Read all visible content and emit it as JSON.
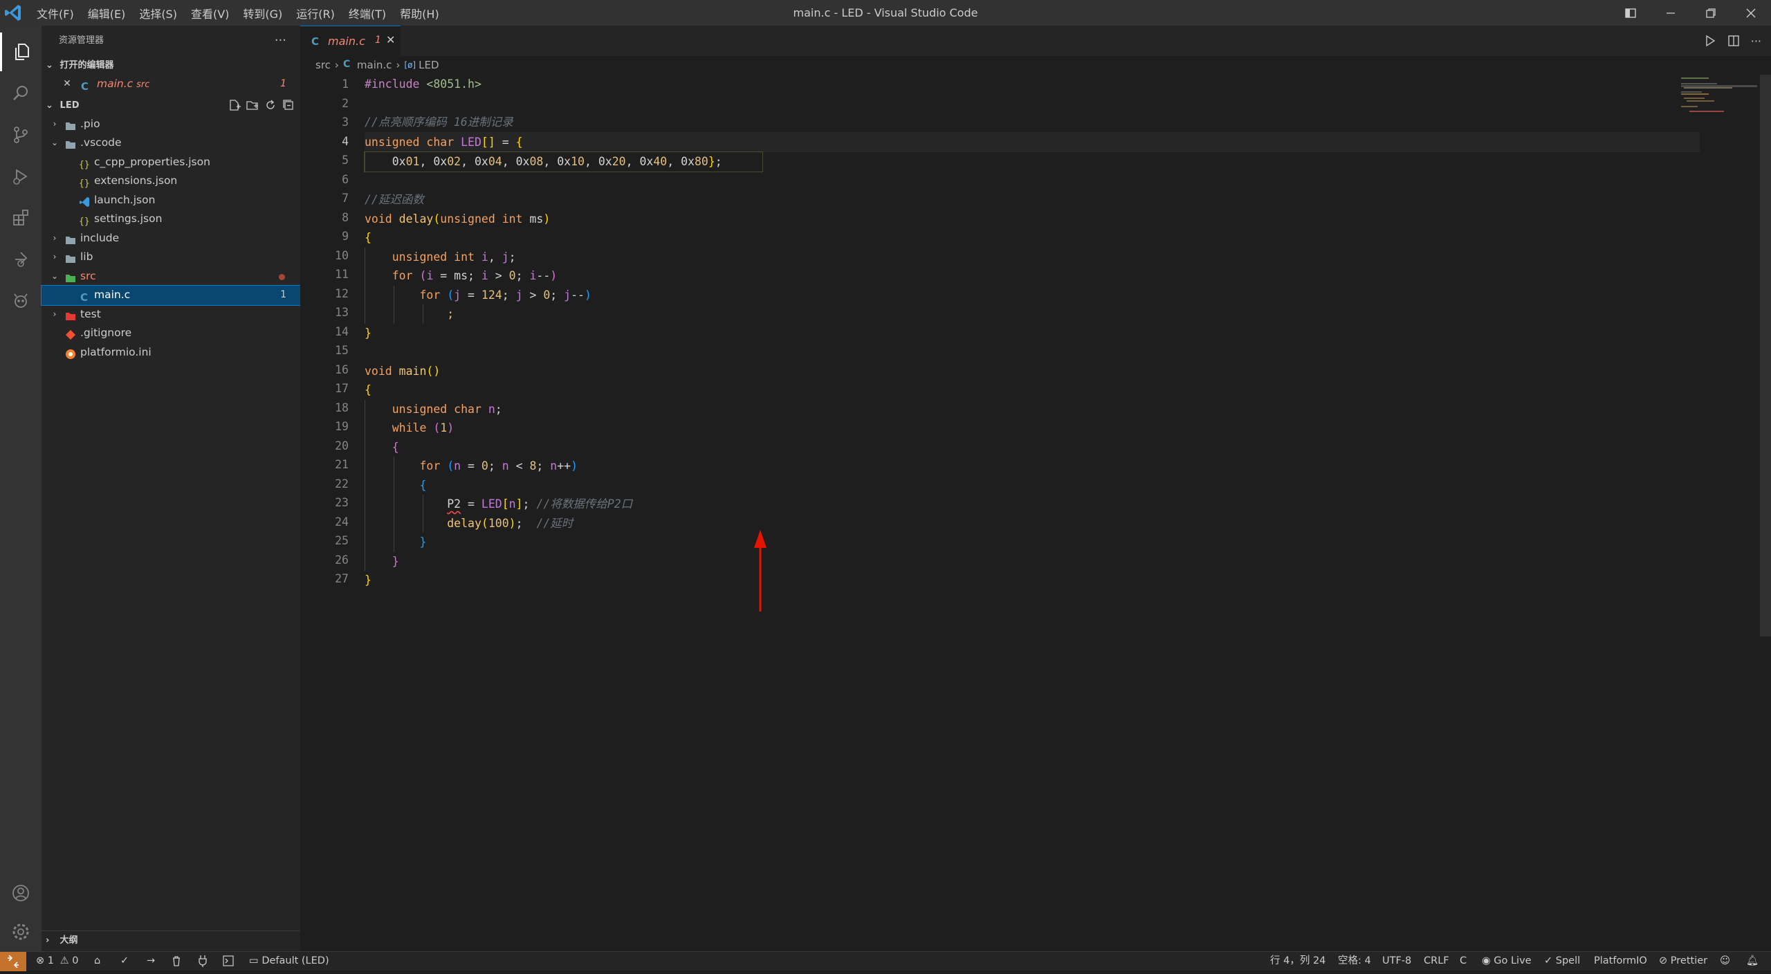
{
  "window": {
    "title": "main.c - LED - Visual Studio Code",
    "menu": [
      "文件(F)",
      "编辑(E)",
      "选择(S)",
      "查看(V)",
      "转到(G)",
      "运行(R)",
      "终端(T)",
      "帮助(H)"
    ]
  },
  "colors": {
    "accent": "#007acc",
    "selected_row": "#094771",
    "remote": "#c5722d",
    "error": "#f14c4c",
    "annotation_arrow": "#e51400"
  },
  "activity_bar": {
    "items": [
      "explorer-icon",
      "search-icon",
      "source-control-icon",
      "run-debug-icon",
      "extensions-icon",
      "remote-icon",
      "platformio-icon"
    ],
    "bottom": [
      "account-icon",
      "settings-gear-icon"
    ]
  },
  "sidebar": {
    "title": "资源管理器",
    "open_editors": {
      "title": "打开的编辑器",
      "items": [
        {
          "name": "main.c",
          "path": "src",
          "badge": "1"
        }
      ]
    },
    "project": {
      "title": "LED",
      "tree": [
        {
          "name": ".pio",
          "type": "folder",
          "depth": 0,
          "expanded": false,
          "badge": ""
        },
        {
          "name": ".vscode",
          "type": "folder",
          "depth": 0,
          "expanded": true,
          "badge": ""
        },
        {
          "name": "c_cpp_properties.json",
          "type": "json",
          "depth": 1,
          "badge": ""
        },
        {
          "name": "extensions.json",
          "type": "json",
          "depth": 1,
          "badge": ""
        },
        {
          "name": "launch.json",
          "type": "vscode",
          "depth": 1,
          "badge": ""
        },
        {
          "name": "settings.json",
          "type": "json",
          "depth": 1,
          "badge": ""
        },
        {
          "name": "include",
          "type": "folder",
          "depth": 0,
          "expanded": false,
          "badge": ""
        },
        {
          "name": "lib",
          "type": "folder",
          "depth": 0,
          "expanded": false,
          "badge": ""
        },
        {
          "name": "src",
          "type": "folder-src",
          "depth": 0,
          "expanded": true,
          "badge": "dot"
        },
        {
          "name": "main.c",
          "type": "c",
          "depth": 1,
          "badge": "1",
          "selected": true
        },
        {
          "name": "test",
          "type": "folder-test",
          "depth": 0,
          "expanded": false,
          "badge": ""
        },
        {
          "name": ".gitignore",
          "type": "git",
          "depth": 0,
          "badge": ""
        },
        {
          "name": "platformio.ini",
          "type": "pio",
          "depth": 0,
          "badge": ""
        }
      ]
    },
    "outline_title": "大纲"
  },
  "tab": {
    "label": "main.c",
    "badge": "1"
  },
  "breadcrumb": [
    "src",
    "main.c",
    "LED"
  ],
  "code": {
    "current_line": 4,
    "lines": [
      [
        [
          "pp",
          "#include "
        ],
        [
          "inc",
          "<8051.h>"
        ]
      ],
      [],
      [
        [
          "cm",
          "//点亮顺序编码 16进制记录"
        ]
      ],
      [
        [
          "ty",
          "unsigned "
        ],
        [
          "ty",
          "char "
        ],
        [
          "id",
          "LED"
        ],
        [
          "br1",
          "[]"
        ],
        [
          "var",
          " = "
        ],
        [
          "br1",
          "{"
        ]
      ],
      [
        [
          "var",
          "    0x"
        ],
        [
          "num",
          "01"
        ],
        [
          "var",
          ", 0x"
        ],
        [
          "num",
          "02"
        ],
        [
          "var",
          ", 0x"
        ],
        [
          "num",
          "04"
        ],
        [
          "var",
          ", 0x"
        ],
        [
          "num",
          "08"
        ],
        [
          "var",
          ", 0x"
        ],
        [
          "num",
          "10"
        ],
        [
          "var",
          ", 0x"
        ],
        [
          "num",
          "20"
        ],
        [
          "var",
          ", 0x"
        ],
        [
          "num",
          "40"
        ],
        [
          "var",
          ", 0x"
        ],
        [
          "num",
          "80"
        ],
        [
          "br1",
          "}"
        ],
        [
          "var",
          ";"
        ]
      ],
      [],
      [
        [
          "cm",
          "//延迟函数"
        ]
      ],
      [
        [
          "ty",
          "void "
        ],
        [
          "fn",
          "delay"
        ],
        [
          "br1",
          "("
        ],
        [
          "ty",
          "unsigned "
        ],
        [
          "ty",
          "int "
        ],
        [
          "var",
          "ms"
        ],
        [
          "br1",
          ")"
        ]
      ],
      [
        [
          "br1",
          "{"
        ]
      ],
      [
        [
          "var",
          "    "
        ],
        [
          "ty",
          "unsigned "
        ],
        [
          "ty",
          "int "
        ],
        [
          "id",
          "i"
        ],
        [
          "var",
          ", "
        ],
        [
          "id",
          "j"
        ],
        [
          "var",
          ";"
        ]
      ],
      [
        [
          "var",
          "    "
        ],
        [
          "kw",
          "for "
        ],
        [
          "br2",
          "("
        ],
        [
          "id",
          "i"
        ],
        [
          "var",
          " = ms; "
        ],
        [
          "id",
          "i"
        ],
        [
          "var",
          " > "
        ],
        [
          "num",
          "0"
        ],
        [
          "var",
          "; "
        ],
        [
          "id",
          "i"
        ],
        [
          "var",
          "--"
        ],
        [
          "br2",
          ")"
        ]
      ],
      [
        [
          "var",
          "        "
        ],
        [
          "kw",
          "for "
        ],
        [
          "br3",
          "("
        ],
        [
          "id",
          "j"
        ],
        [
          "var",
          " = "
        ],
        [
          "num",
          "124"
        ],
        [
          "var",
          "; "
        ],
        [
          "id",
          "j"
        ],
        [
          "var",
          " > "
        ],
        [
          "num",
          "0"
        ],
        [
          "var",
          "; "
        ],
        [
          "id",
          "j"
        ],
        [
          "var",
          "--"
        ],
        [
          "br3",
          ")"
        ]
      ],
      [
        [
          "var",
          "            "
        ],
        [
          "num",
          ";"
        ]
      ],
      [
        [
          "br1",
          "}"
        ]
      ],
      [],
      [
        [
          "ty",
          "void "
        ],
        [
          "fn",
          "main"
        ],
        [
          "br1",
          "()"
        ]
      ],
      [
        [
          "br1",
          "{"
        ]
      ],
      [
        [
          "var",
          "    "
        ],
        [
          "ty",
          "unsigned "
        ],
        [
          "ty",
          "char "
        ],
        [
          "id",
          "n"
        ],
        [
          "var",
          ";"
        ]
      ],
      [
        [
          "var",
          "    "
        ],
        [
          "kw",
          "while "
        ],
        [
          "br2",
          "("
        ],
        [
          "num",
          "1"
        ],
        [
          "br2",
          ")"
        ]
      ],
      [
        [
          "var",
          "    "
        ],
        [
          "br2",
          "{"
        ]
      ],
      [
        [
          "var",
          "        "
        ],
        [
          "kw",
          "for "
        ],
        [
          "br3",
          "("
        ],
        [
          "id",
          "n"
        ],
        [
          "var",
          " = "
        ],
        [
          "num",
          "0"
        ],
        [
          "var",
          "; "
        ],
        [
          "id",
          "n"
        ],
        [
          "var",
          " < "
        ],
        [
          "num",
          "8"
        ],
        [
          "var",
          "; "
        ],
        [
          "id",
          "n"
        ],
        [
          "var",
          "++"
        ],
        [
          "br3",
          ")"
        ]
      ],
      [
        [
          "var",
          "        "
        ],
        [
          "br3",
          "{"
        ]
      ],
      [
        [
          "var",
          "            "
        ],
        [
          "sq",
          "P2"
        ],
        [
          "var",
          " = "
        ],
        [
          "id",
          "LED"
        ],
        [
          "br1",
          "["
        ],
        [
          "id",
          "n"
        ],
        [
          "br1",
          "]"
        ],
        [
          "var",
          "; "
        ],
        [
          "cm",
          "//将数据传给P2口"
        ]
      ],
      [
        [
          "var",
          "            "
        ],
        [
          "fn",
          "delay"
        ],
        [
          "br1",
          "("
        ],
        [
          "num",
          "100"
        ],
        [
          "br1",
          ")"
        ],
        [
          "var",
          ";  "
        ],
        [
          "cm",
          "//延时"
        ]
      ],
      [
        [
          "var",
          "        "
        ],
        [
          "br3",
          "}"
        ]
      ],
      [
        [
          "var",
          "    "
        ],
        [
          "br2",
          "}"
        ]
      ],
      [
        [
          "br1",
          "}"
        ]
      ]
    ]
  },
  "status": {
    "errors": "1",
    "warnings": "0",
    "env": "Default (LED)",
    "position": "行 4，列 24",
    "spaces": "空格: 4",
    "encoding": "UTF-8",
    "eol": "CRLF",
    "language": "C",
    "golive": "Go Live",
    "spell": "Spell",
    "platformio": "PlatformIO",
    "prettier": "Prettier"
  }
}
